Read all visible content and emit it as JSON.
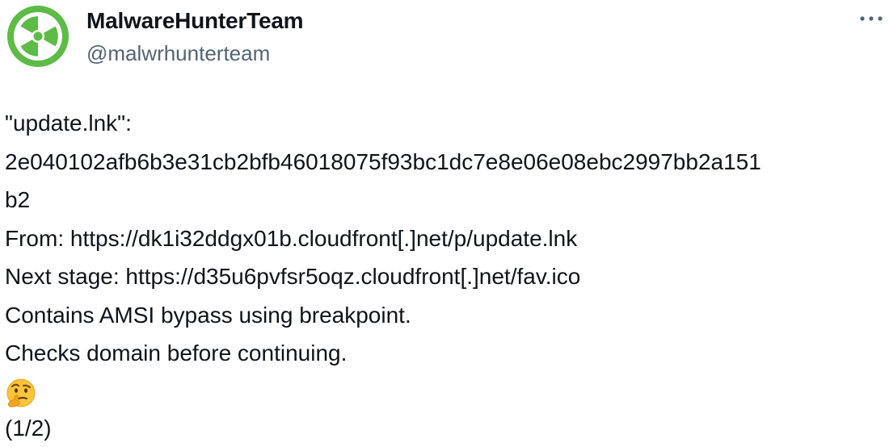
{
  "tweet": {
    "author": {
      "display_name": "MalwareHunterTeam",
      "handle": "@malwrhunterteam",
      "avatar_icon": "radiation-trefoil-icon",
      "avatar_color": "#5dbb46"
    },
    "more_icon": "more-options-icon",
    "lines": [
      "\"update.lnk\":",
      "2e040102afb6b3e31cb2bfb46018075f93bc1dc7e8e06e08ebc2997bb2a151",
      "b2",
      "From: https://dk1i32ddgx01b.cloudfront[.]net/p/update.lnk",
      "Next stage: https://d35u6pvfsr5oqz.cloudfront[.]net/fav.ico",
      "Contains AMSI bypass using breakpoint.",
      "Checks domain before continuing."
    ],
    "emoji_icon": "thinking-face-emoji",
    "thread_indicator": "(1/2)"
  }
}
